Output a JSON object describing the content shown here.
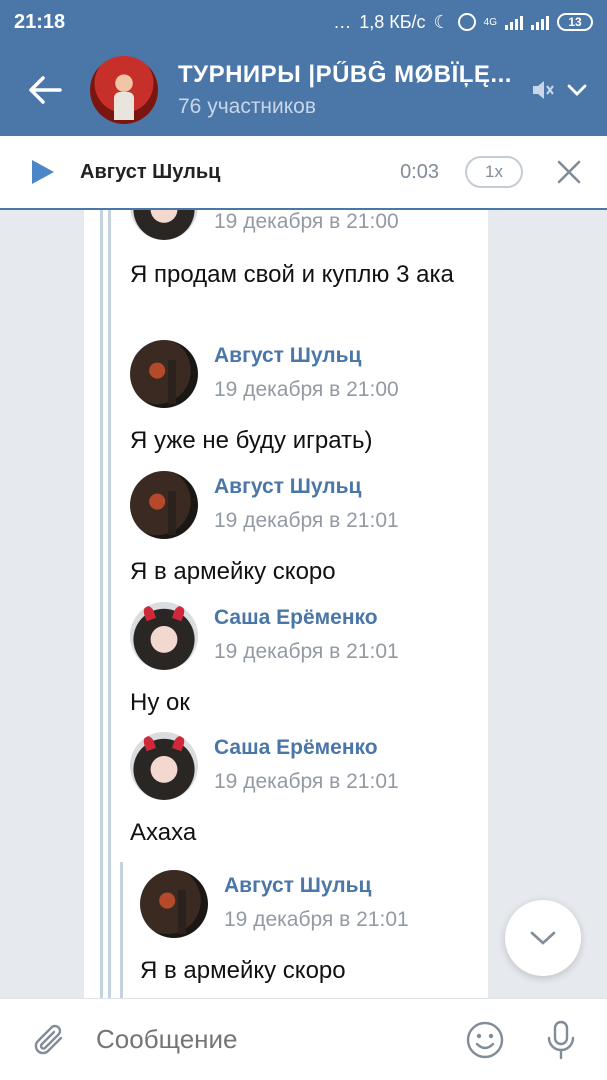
{
  "status_bar": {
    "time": "21:18",
    "net_speed": "1,8 КБ/с",
    "network_type": "4G",
    "battery": "13"
  },
  "header": {
    "title": "ТУРНИРЫ |PŰBĜ MØBÏĻĘ...",
    "subtitle": "76 участников"
  },
  "player": {
    "track": "Август Шульц",
    "time": "0:03",
    "speed": "1x"
  },
  "messages": [
    {
      "author": "",
      "date": "19 декабря в 21:00",
      "text": "Я продам свой и куплю 3 ака",
      "avatar": "girl"
    },
    {
      "author": "Август Шульц",
      "date": "19 декабря в 21:00",
      "text": "Я уже не буду играть)",
      "avatar": "dark"
    },
    {
      "author": "Август Шульц",
      "date": "19 декабря в 21:01",
      "text": "Я в армейку скоро",
      "avatar": "dark"
    },
    {
      "author": "Саша Ерёменко",
      "date": "19 декабря в 21:01",
      "text": "Ну ок",
      "avatar": "girl"
    },
    {
      "author": "Саша Ерёменко",
      "date": "19 декабря в 21:01",
      "text": "Ахаха",
      "avatar": "girl"
    },
    {
      "author": "Август Шульц",
      "date": "19 декабря в 21:01",
      "text": "Я в армейку скоро",
      "avatar": "dark"
    }
  ],
  "composer": {
    "placeholder": "Сообщение"
  },
  "icons": {
    "back": "arrow-left-icon",
    "mute": "muted-speaker-icon",
    "menu": "chevron-down-icon",
    "play": "play-icon",
    "close": "close-icon",
    "scroll_down": "chevron-down-icon",
    "attach": "paperclip-icon",
    "emoji": "smiley-icon",
    "mic": "microphone-icon"
  },
  "colors": {
    "accent": "#4a76a8",
    "author": "#4a76a8",
    "muted_text": "#939aa3"
  }
}
